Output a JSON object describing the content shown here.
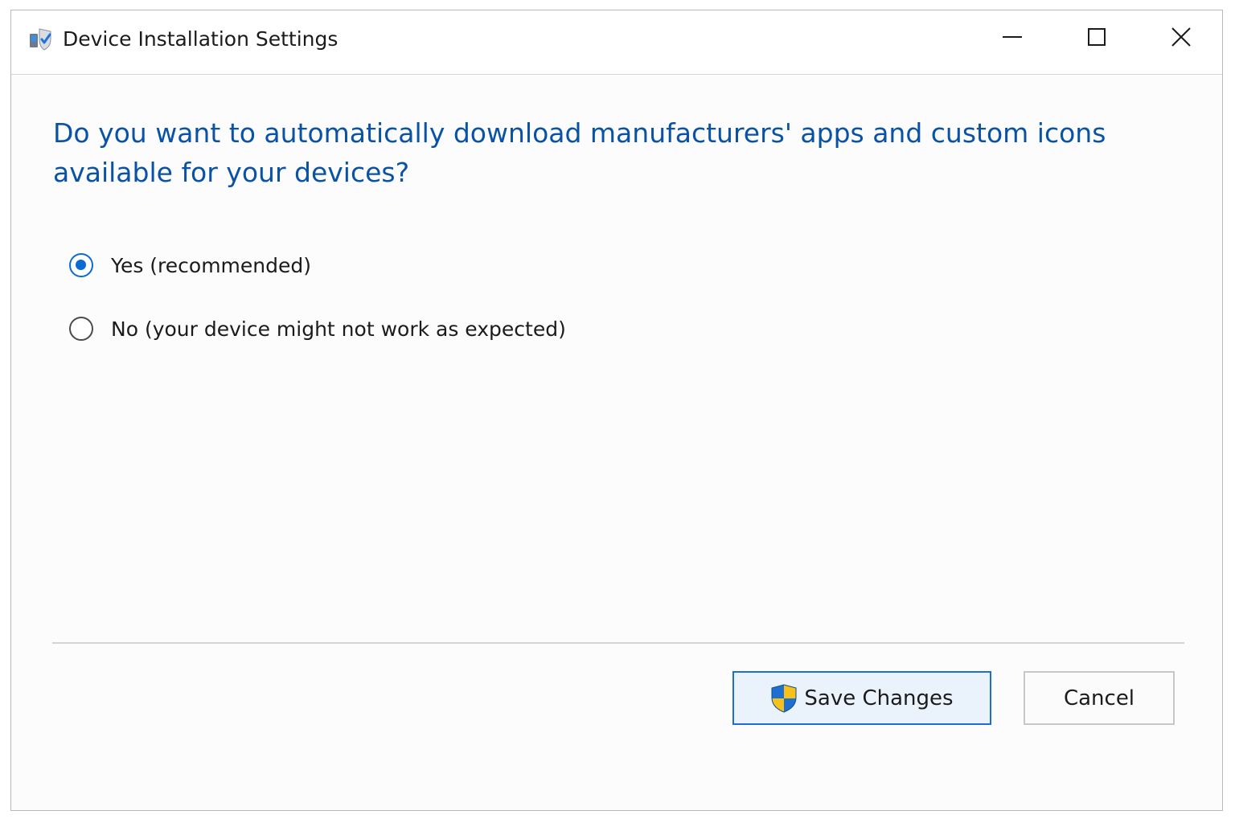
{
  "window": {
    "title": "Device Installation Settings",
    "icon": "device-settings-shield-icon"
  },
  "controls": {
    "minimize_icon": "minimize-icon",
    "maximize_icon": "maximize-icon",
    "close_icon": "close-icon"
  },
  "content": {
    "question": "Do you want to automatically download manufacturers' apps and custom icons available for your devices?",
    "options": [
      {
        "label": "Yes (recommended)",
        "selected": true
      },
      {
        "label": "No (your device might not work as expected)",
        "selected": false
      }
    ]
  },
  "buttons": {
    "save_label": "Save Changes",
    "save_icon": "uac-shield-icon",
    "cancel_label": "Cancel"
  },
  "colors": {
    "heading": "#0a52a4",
    "accent": "#0a6bd1",
    "save_bg": "#eaf3fc",
    "save_border": "#1a6fcf"
  }
}
